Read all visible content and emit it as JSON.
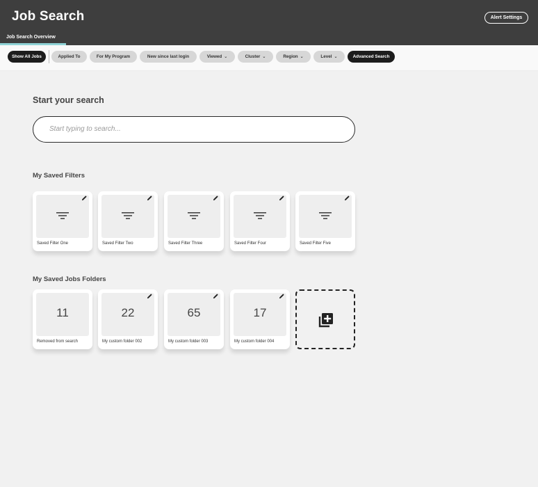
{
  "header": {
    "title": "Job Search",
    "alert_settings_label": "Alert Settings",
    "active_tab": "Job Search Overview"
  },
  "filter_chips": [
    {
      "label": "Show All Jobs",
      "style": "dark"
    },
    {
      "label": "Applied To",
      "style": "light"
    },
    {
      "label": "For My Program",
      "style": "light"
    },
    {
      "label": "New since last login",
      "style": "light"
    },
    {
      "label": "Viewed",
      "style": "light",
      "dropdown": true
    },
    {
      "label": "Cluster",
      "style": "light",
      "dropdown": true
    },
    {
      "label": "Region",
      "style": "light",
      "dropdown": true
    },
    {
      "label": "Level",
      "style": "light",
      "dropdown": true
    },
    {
      "label": "Advanced Search",
      "style": "dark"
    }
  ],
  "search": {
    "title": "Start your search",
    "placeholder": "Start typing to search..."
  },
  "saved_filters": {
    "title": "My Saved Filters",
    "items": [
      {
        "label": "Saved Filter One"
      },
      {
        "label": "Saved Filter Two"
      },
      {
        "label": "Saved Filter Three"
      },
      {
        "label": "Saved Filter Four"
      },
      {
        "label": "Saved Filter Five"
      }
    ]
  },
  "saved_folders": {
    "title": "My Saved Jobs Folders",
    "items": [
      {
        "count": "11",
        "label": "Removed from search",
        "editable": false
      },
      {
        "count": "22",
        "label": "My custom folder 002",
        "editable": true
      },
      {
        "count": "65",
        "label": "My custom folder 003",
        "editable": true
      },
      {
        "count": "17",
        "label": "My custom folder 004",
        "editable": true
      }
    ]
  },
  "colors": {
    "header_bg": "#3e3e3e",
    "tab_accent": "#8fd3d6",
    "chip_dark": "#1d1d1d",
    "chip_light": "#d7d7d7",
    "page_bg": "#f1f1f1"
  },
  "icons": {
    "edit": "pencil-icon",
    "filter": "filter-icon",
    "add_folder": "add-to-library-icon",
    "dropdown": "chevron-down-icon"
  }
}
